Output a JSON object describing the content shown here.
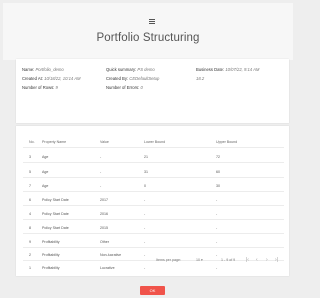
{
  "header": {
    "menu_icon": "hamburger-menu-icon",
    "title": "Portfolio Structuring"
  },
  "info": {
    "name_label": "Name:",
    "name_value": "Portfolio_demo",
    "created_at_label": "Created At:",
    "created_at_value": "10/18/22, 10:14 AM",
    "rows_label": "Number of Rows:",
    "rows_value": "9",
    "quick_summary_label": "Quick summary:",
    "quick_summary_value": "PS demo",
    "created_by_label": "Created By:",
    "created_by_value": "CEDefaultSetup",
    "errors_label": "Number of Errors:",
    "errors_value": "0",
    "business_date_label": "Business Date:",
    "business_date_value": "10/07/22, 9:14 AM",
    "version_label": "",
    "version_value": "18.2"
  },
  "table": {
    "headers": [
      "No.",
      "Property Name",
      "Value",
      "Lower Bound",
      "Upper Bound"
    ],
    "rows": [
      [
        "3",
        "Age",
        "-",
        "21",
        "72"
      ],
      [
        "5",
        "Age",
        "-",
        "31",
        "60"
      ],
      [
        "7",
        "Age",
        "-",
        "0",
        "30"
      ],
      [
        "6",
        "Policy Start Date",
        "2017",
        "-",
        "-"
      ],
      [
        "4",
        "Policy Start Date",
        "2016",
        "-",
        "-"
      ],
      [
        "8",
        "Policy Start Date",
        "2015",
        "-",
        "-"
      ],
      [
        "9",
        "Profitability",
        "Other",
        "-",
        "-"
      ],
      [
        "2",
        "Profitability",
        "Non-lucrative",
        "-",
        "-"
      ],
      [
        "1",
        "Profitability",
        "Lucrative",
        "-",
        "-"
      ]
    ]
  },
  "pagination": {
    "items_per_page_label": "Items per page:",
    "items_per_page_value": "10",
    "range_text": "1 - 9 of 9",
    "first_icon": "first-page-icon",
    "prev_icon": "prev-page-icon",
    "next_icon": "next-page-icon",
    "last_icon": "last-page-icon"
  },
  "actions": {
    "ok_label": "OK",
    "ok_color": "#f0534a"
  }
}
